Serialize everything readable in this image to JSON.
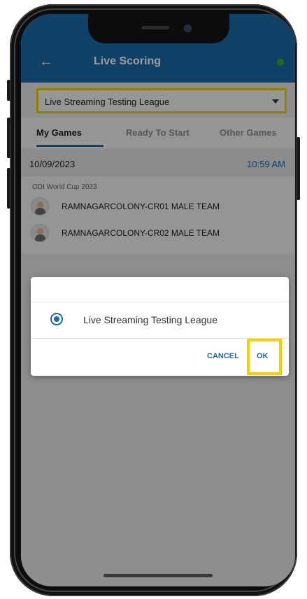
{
  "app": {
    "title": "Live Scoring",
    "back_icon": "back-arrow-icon",
    "status_color": "#3fae2a"
  },
  "league_select": {
    "value": "Live Streaming Testing League",
    "icon": "chevron-down-icon"
  },
  "tabs": [
    {
      "label": "My Games",
      "active": true
    },
    {
      "label": "Ready To Start",
      "active": false
    },
    {
      "label": "Other Games",
      "active": false
    }
  ],
  "game": {
    "date": "10/09/2023",
    "time": "10:59 AM",
    "competition": "ODI World Cup 2023",
    "teams": [
      {
        "name": "RAMNAGARCOLONY-CR01 MALE TEAM",
        "icon": "team-avatar-icon"
      },
      {
        "name": "RAMNAGARCOLONY-CR02 MALE TEAM",
        "icon": "team-avatar-icon"
      }
    ]
  },
  "dialog": {
    "option_label": "Live Streaming Testing League",
    "option_selected": true,
    "cancel_label": "CANCEL",
    "ok_label": "OK"
  },
  "colors": {
    "primary": "#1b6aa8",
    "highlight": "#f3d000"
  }
}
